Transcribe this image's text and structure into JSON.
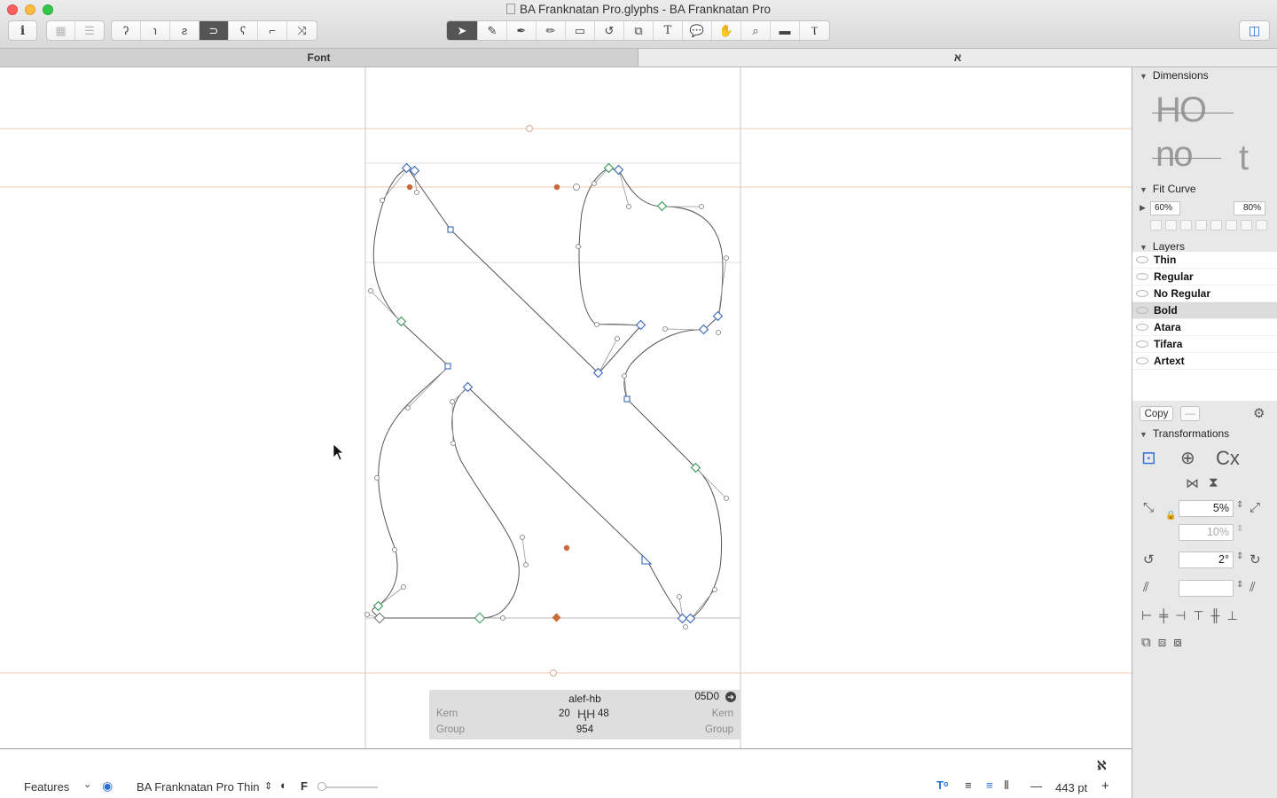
{
  "window": {
    "title": "BA Franknatan Pro.glyphs - BA Franknatan Pro"
  },
  "toolbar": {
    "info_icon": "info-icon",
    "view_modes": [
      "grid-view-icon",
      "list-view-icon"
    ],
    "path_tools": [
      "corner-icon",
      "cap-icon",
      "segment-icon",
      "smooth-icon",
      "brush-icon",
      "stamp-icon",
      "transform-icon"
    ],
    "edit_tools": [
      "select-icon",
      "draw-icon",
      "pen-icon",
      "pencil-icon",
      "primitives-icon",
      "rotate-icon",
      "scale-icon",
      "text-tool-icon",
      "annotation-icon",
      "hand-icon",
      "zoom-icon",
      "measure-icon",
      "text-edit-icon"
    ],
    "sidebar_toggle": "sidebar-toggle-icon"
  },
  "tabs": {
    "font_tab": "Font",
    "glyph_tab": "א"
  },
  "glyph_info": {
    "name": "alef-hb",
    "unicode": "05D0",
    "left_kern_label": "Kern",
    "right_kern_label": "Kern",
    "left_group_label": "Group",
    "right_group_label": "Group",
    "lsb": "20",
    "rsb": "48",
    "width": "954"
  },
  "bottom_bar": {
    "features_label": "Features",
    "master_name": "BA Franknatan Pro Thin",
    "f_label": "F",
    "zoom": "443 pt",
    "minus": "—",
    "plus": "+"
  },
  "panel": {
    "dimensions_title": "Dimensions",
    "fit_curve_title": "Fit Curve",
    "fit_min": "60%",
    "fit_max": "80%",
    "layers_title": "Layers",
    "layers": [
      {
        "name": "Thin",
        "selected": false
      },
      {
        "name": "Regular",
        "selected": false
      },
      {
        "name": "No Regular",
        "selected": false
      },
      {
        "name": "Bold",
        "selected": true
      },
      {
        "name": "Atara",
        "selected": false
      },
      {
        "name": "Tifara",
        "selected": false
      },
      {
        "name": "Artext",
        "selected": false
      }
    ],
    "copy_label": "Copy",
    "minus_label": "—",
    "transformations_title": "Transformations",
    "scale_value": "5%",
    "scale_value2": "10%",
    "rotate_value": "2°",
    "slant_value": ""
  },
  "colors": {
    "metric_line": "#f3c4b0",
    "node_blue": "#3a68b8",
    "node_green": "#3c9b5b",
    "anchor": "#c86a3a"
  }
}
